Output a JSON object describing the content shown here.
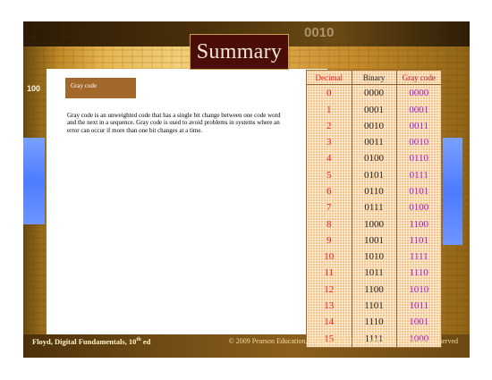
{
  "slide": {
    "title": "Summary",
    "section_label": "Gray code",
    "body": "Gray code is an unweighted code that has a single bit change between one code word and the next in a sequence. Gray code is used to avoid problems in systems where an error can occur if more than one bit changes at a time.",
    "background_numbers": [
      "100",
      "0010"
    ]
  },
  "table": {
    "headers": [
      "Decimal",
      "Binary",
      "Gray code"
    ],
    "rows": [
      [
        "0",
        "0000",
        "0000"
      ],
      [
        "1",
        "0001",
        "0001"
      ],
      [
        "2",
        "0010",
        "0011"
      ],
      [
        "3",
        "0011",
        "0010"
      ],
      [
        "4",
        "0100",
        "0110"
      ],
      [
        "5",
        "0101",
        "0111"
      ],
      [
        "6",
        "0110",
        "0101"
      ],
      [
        "7",
        "0111",
        "0100"
      ],
      [
        "8",
        "1000",
        "1100"
      ],
      [
        "9",
        "1001",
        "1101"
      ],
      [
        "10",
        "1010",
        "1111"
      ],
      [
        "11",
        "1011",
        "1110"
      ],
      [
        "12",
        "1100",
        "1010"
      ],
      [
        "13",
        "1101",
        "1011"
      ],
      [
        "14",
        "1110",
        "1001"
      ],
      [
        "15",
        "1111",
        "1000"
      ]
    ]
  },
  "footer": {
    "left_prefix": "Floyd, Digital Fundamentals, 10",
    "left_sup": "th",
    "left_suffix": " ed",
    "right": "© 2009 Pearson Education, Upper Saddle River, NJ 07458. All Rights Reserved"
  },
  "colors": {
    "decimal": "#ee1c1c",
    "binary": "#222222",
    "gray": "#9a1fd6",
    "title_bg": "#4a0d0a",
    "section_bg": "#a2682c"
  }
}
